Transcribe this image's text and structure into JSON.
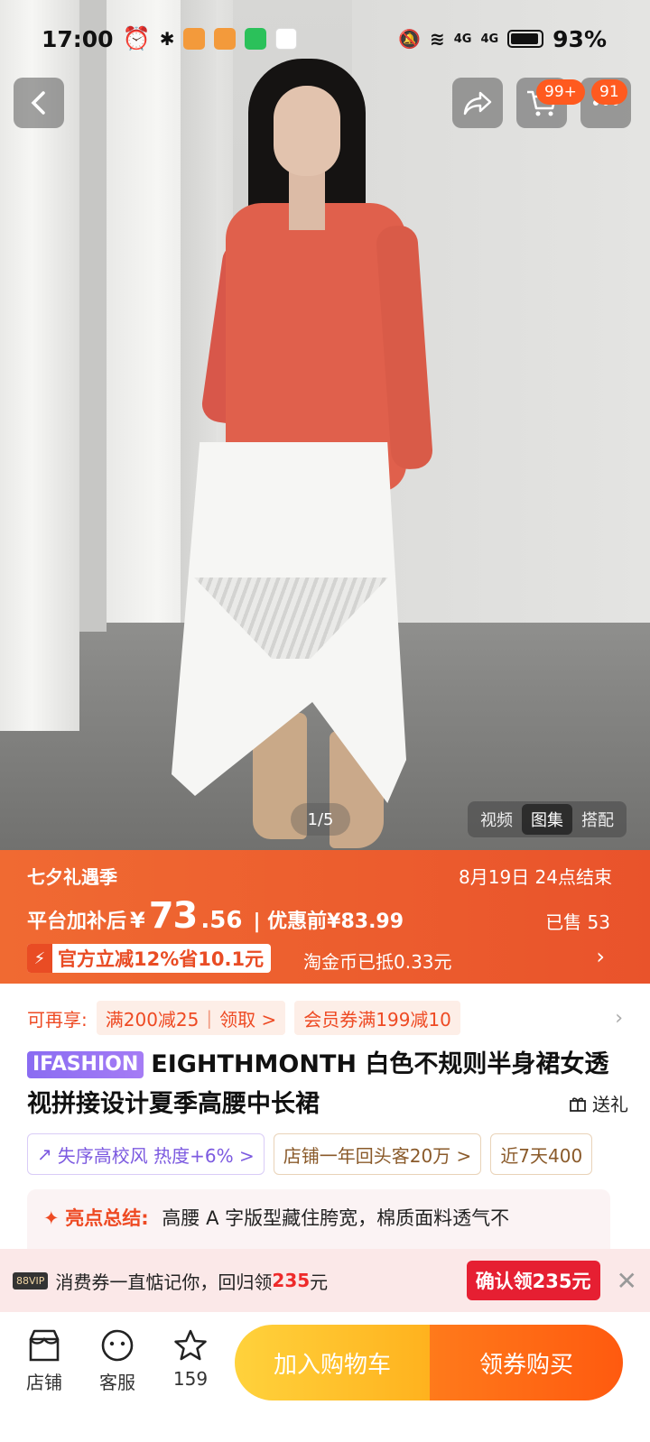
{
  "status_bar": {
    "time": "17:00",
    "battery": "93%",
    "signal_1": "4G",
    "signal_2": "4G"
  },
  "gallery": {
    "counter": "1/5",
    "tabs": [
      "视频",
      "图集",
      "搭配"
    ],
    "active_tab": "图集"
  },
  "header": {
    "cart_badge": "99+",
    "more_badge": "91"
  },
  "promo": {
    "event": "七夕礼遇季",
    "ends": "8月19日 24点结束",
    "price_label": "平台加补后",
    "currency": "¥",
    "price_int": "73",
    "price_dec": ".56",
    "pre_price": "| 优惠前¥83.99",
    "sold": "已售 53",
    "discount_tag": "官方立减12%省10.1元",
    "coin": "淘金币已抵0.33元"
  },
  "coupons": {
    "label": "可再享:",
    "chip1_a": "满200减25",
    "chip1_b": "领取 >",
    "chip2": "会员券满199减10"
  },
  "product": {
    "brand_tag": "IFASHION",
    "title": "EIGHTHMONTH 白色不规则半身裙女透视拼接设计夏季高腰中长裙",
    "gift": "送礼"
  },
  "tags": [
    "失序高校风 热度+6% >",
    "店铺一年回头客20万 >",
    "近7天400"
  ],
  "highlight": {
    "label": "亮点总结:",
    "text": "高腰 A 字版型藏住胯宽，棉质面料透气不"
  },
  "voucher": {
    "vip": "88VIP",
    "text": "消费券一直惦记你，回归领",
    "amount": "235",
    "unit": "元",
    "button": "确认领235元"
  },
  "bottom": {
    "shop": "店铺",
    "service": "客服",
    "fav_count": "159",
    "add_cart": "加入购物车",
    "buy": "领券购买"
  },
  "colors": {
    "accent": "#ee4a23",
    "promo_bg": "#ec5d2e",
    "brand_purple": "#8a6cf2"
  }
}
